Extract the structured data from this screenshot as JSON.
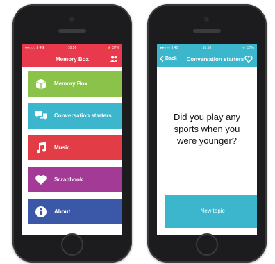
{
  "colors": {
    "header_red": "#e8394d",
    "header_teal": "#3bb6cc",
    "memory_box": "#8bc34a",
    "conversation": "#3bb6cc",
    "music": "#e23c47",
    "scrapbook": "#a23a96",
    "about": "#3b58a8"
  },
  "left_phone": {
    "status": {
      "carrier": "●●○○○ 3  4G",
      "time": "10:56",
      "battery": "⚡ 37%"
    },
    "header": {
      "title": "Memory Box",
      "icon": "users-icon"
    },
    "menu": [
      {
        "label": "Memory Box",
        "icon": "box-icon",
        "color": "#8bc34a"
      },
      {
        "label": "Conversation starters",
        "icon": "speech-bubbles-icon",
        "color": "#3bb6cc"
      },
      {
        "label": "Music",
        "icon": "music-note-icon",
        "color": "#e23c47"
      },
      {
        "label": "Scrapbook",
        "icon": "heart-icon",
        "color": "#a23a96"
      },
      {
        "label": "About",
        "icon": "info-icon",
        "color": "#3b58a8"
      }
    ]
  },
  "right_phone": {
    "status": {
      "carrier": "●●○○○ 3  4G",
      "time": "10:58",
      "battery": "⚡ 37%"
    },
    "header": {
      "back_label": "Back",
      "title": "Conversation starters",
      "icon": "heart-outline-icon"
    },
    "question": "Did you play any sports when you were younger?",
    "button_label": "New topic"
  }
}
